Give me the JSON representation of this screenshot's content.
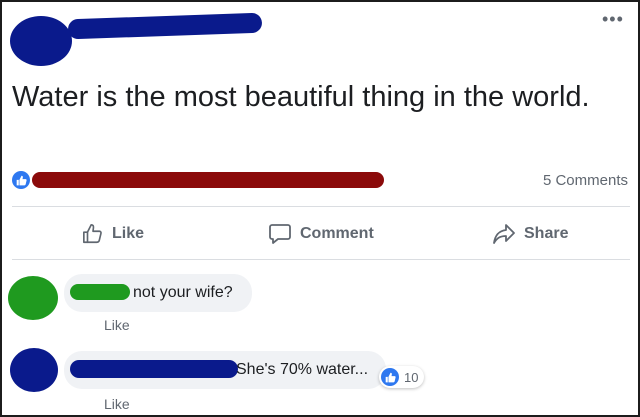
{
  "post": {
    "menu_glyph": "•••",
    "text": "Water is the most beautiful thing in the world.",
    "comments_count": "5 Comments"
  },
  "actions": {
    "like": "Like",
    "comment": "Comment",
    "share": "Share"
  },
  "comments": [
    {
      "text": "not your wife?",
      "like_label": "Like"
    },
    {
      "text": "She's 70% water...",
      "like_label": "Like",
      "reaction_count": "10"
    }
  ],
  "colors": {
    "redaction_blue": "#0a1a8c",
    "redaction_red": "#8b0a0a",
    "redaction_green": "#1f9a1f",
    "facebook_blue": "#2e78f0"
  },
  "icons": [
    "more-icon",
    "like-reaction-icon",
    "thumbs-up-icon",
    "comment-icon",
    "share-icon"
  ]
}
